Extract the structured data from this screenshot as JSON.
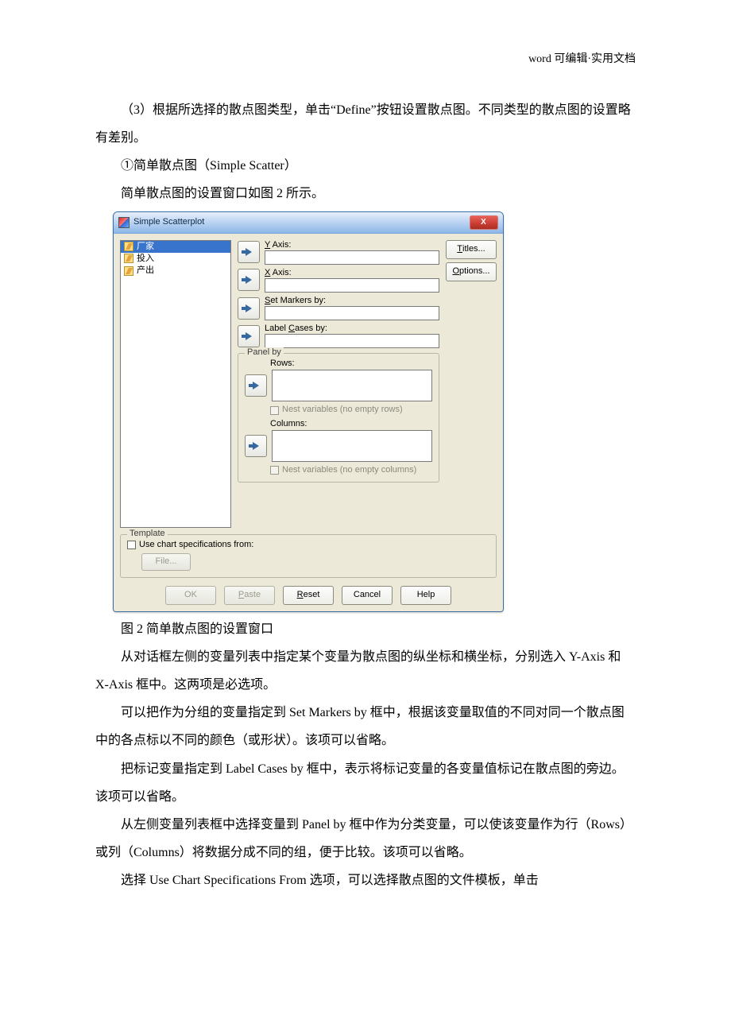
{
  "page_header": "word 可编辑·实用文档",
  "body_text": {
    "p1": "（3）根据所选择的散点图类型，单击“Define”按钮设置散点图。不同类型的散点图的设置略有差别。",
    "p2": "①简单散点图（Simple Scatter）",
    "p3": "简单散点图的设置窗口如图 2 所示。",
    "caption": "图 2  简单散点图的设置窗口",
    "p4": "从对话框左侧的变量列表中指定某个变量为散点图的纵坐标和横坐标，分别选入 Y-Axis 和 X-Axis 框中。这两项是必选项。",
    "p5": "可以把作为分组的变量指定到 Set Markers by 框中，根据该变量取值的不同对同一个散点图中的各点标以不同的颜色（或形状）。该项可以省略。",
    "p6": "把标记变量指定到 Label Cases by 框中，表示将标记变量的各变量值标记在散点图的旁边。该项可以省略。",
    "p7": "从左侧变量列表框中选择变量到 Panel by 框中作为分类变量，可以使该变量作为行（Rows）或列（Columns）将数据分成不同的组，便于比较。该项可以省略。",
    "p8": "选择 Use Chart Specifications From 选项，可以选择散点图的文件模板，单击"
  },
  "dialog": {
    "title": "Simple Scatterplot",
    "close_label": "X",
    "variables": [
      "厂家",
      "投入",
      "产出"
    ],
    "fields": {
      "y_axis": "Y Axis:",
      "x_axis": "X Axis:",
      "set_markers": "Set Markers by:",
      "label_cases": "Label Cases by:"
    },
    "panel_by": {
      "title": "Panel by",
      "rows": "Rows:",
      "nest_rows": "Nest variables (no empty rows)",
      "columns": "Columns:",
      "nest_cols": "Nest variables (no empty columns)"
    },
    "template": {
      "title": "Template",
      "use_chart": "Use chart specifications from:",
      "file": "File..."
    },
    "side_buttons": {
      "titles": "Titles...",
      "options": "Options..."
    },
    "buttons": {
      "ok": "OK",
      "paste": "Paste",
      "reset": "Reset",
      "cancel": "Cancel",
      "help": "Help"
    }
  }
}
